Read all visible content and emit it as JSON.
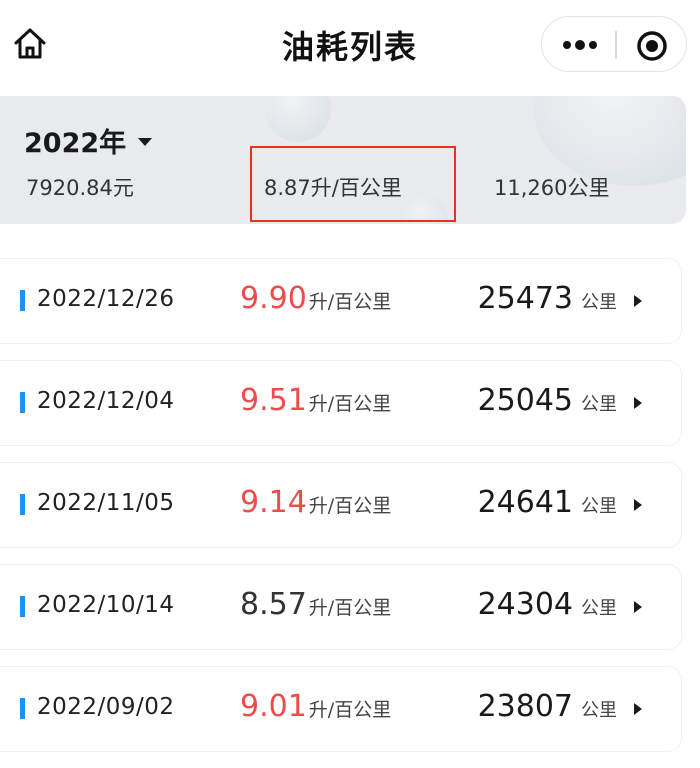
{
  "nav": {
    "title": "油耗列表",
    "home_icon": "home-icon",
    "more_icon": "more-dots-icon",
    "close_icon": "target-circle-icon"
  },
  "summary": {
    "year": "2022年",
    "total_cost": "7920.84元",
    "avg_consumption": "8.87升/百公里",
    "total_distance": "11,260公里"
  },
  "colors": {
    "high": "#f04b4b",
    "normal": "#333333",
    "bar": "#1e90ee",
    "highlight_box": "#e8321e"
  },
  "records": [
    {
      "date": "2022/12/26",
      "consumption": "9.90",
      "unit": "升/百公里",
      "odometer": "25473",
      "odo_unit": "公里",
      "high": true
    },
    {
      "date": "2022/12/04",
      "consumption": "9.51",
      "unit": "升/百公里",
      "odometer": "25045",
      "odo_unit": "公里",
      "high": true
    },
    {
      "date": "2022/11/05",
      "consumption": "9.14",
      "unit": "升/百公里",
      "odometer": "24641",
      "odo_unit": "公里",
      "high": true
    },
    {
      "date": "2022/10/14",
      "consumption": "8.57",
      "unit": "升/百公里",
      "odometer": "24304",
      "odo_unit": "公里",
      "high": false
    },
    {
      "date": "2022/09/02",
      "consumption": "9.01",
      "unit": "升/百公里",
      "odometer": "23807",
      "odo_unit": "公里",
      "high": true
    }
  ]
}
